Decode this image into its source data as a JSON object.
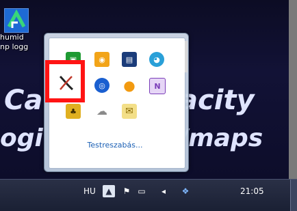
{
  "desktop": {
    "icon_label_line1": "humid",
    "icon_label_line2": "np logg",
    "bg_text": {
      "line1_left": "Ca",
      "line1_right": "acity",
      "line2_left": "ogi",
      "line2_right": "/maps"
    }
  },
  "tray_popup": {
    "customize_link": "Testreszabás...",
    "icons": [
      {
        "name": "green-app-icon",
        "glyph": "▣",
        "color": "#1e9a32"
      },
      {
        "name": "orange-app-icon",
        "glyph": "◉",
        "color": "#f2a418"
      },
      {
        "name": "monitor-app-icon",
        "glyph": "▤",
        "color": "#1b3c7a"
      },
      {
        "name": "globe-app-icon",
        "glyph": "◕",
        "color": "#2aa0d8"
      },
      {
        "name": "xming-x-icon",
        "glyph": "X",
        "color": "#222222"
      },
      {
        "name": "blue-circle-icon",
        "glyph": "◎",
        "color": "#1a5fd0"
      },
      {
        "name": "orange-circle-icon",
        "glyph": "●",
        "color": "#f29a10"
      },
      {
        "name": "onenote-icon",
        "glyph": "N",
        "color": "#7a3db8"
      },
      {
        "name": "yellow-app-icon",
        "glyph": "♣",
        "color": "#e0b020"
      },
      {
        "name": "cloud-icon",
        "glyph": "☁",
        "color": "#8a8a8a"
      },
      {
        "name": "envelope-icon",
        "glyph": "✉",
        "color": "#e6c23a"
      }
    ]
  },
  "taskbar": {
    "language": "HU",
    "clock": "21:05"
  }
}
